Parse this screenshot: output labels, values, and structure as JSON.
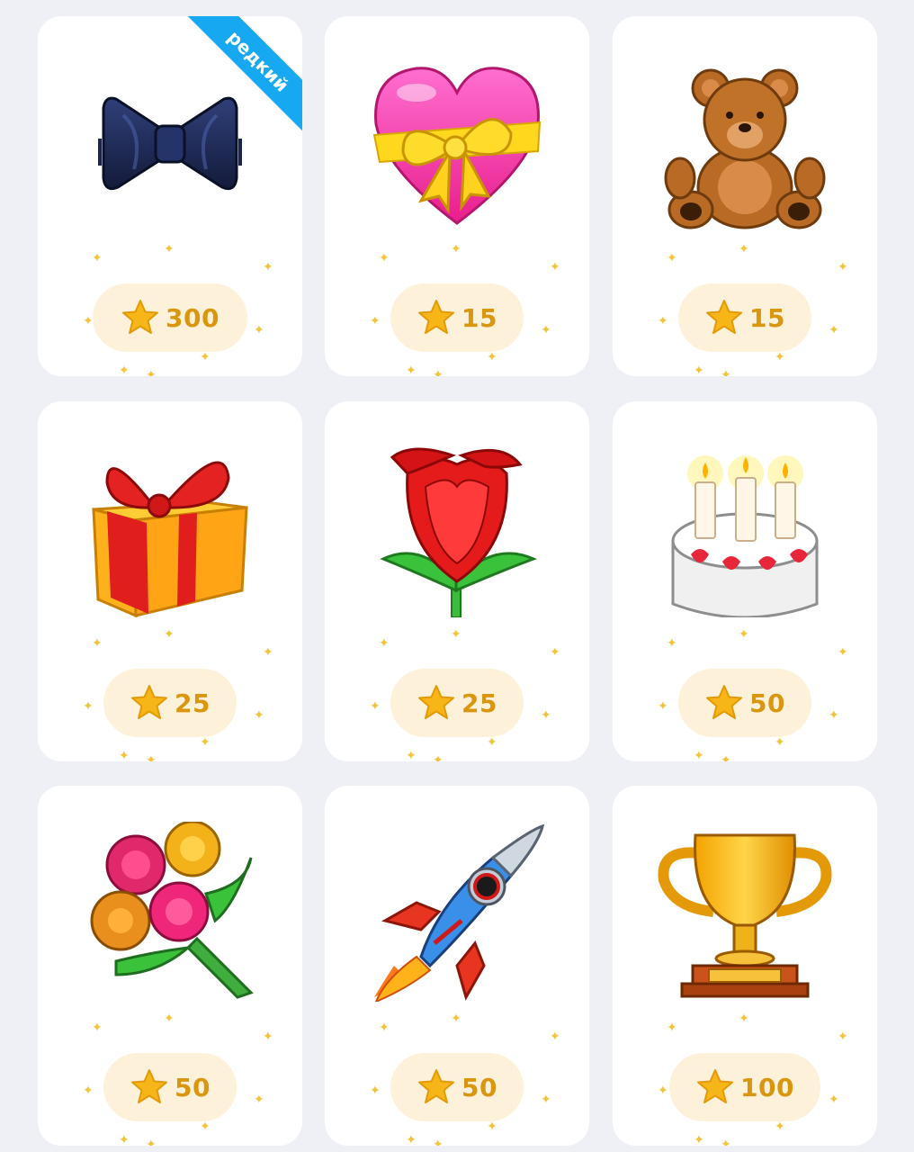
{
  "gifts": [
    {
      "name": "bow-tie",
      "price": "300",
      "badge": "редкий"
    },
    {
      "name": "heart-with-ribbon",
      "price": "15"
    },
    {
      "name": "teddy-bear",
      "price": "15"
    },
    {
      "name": "gift-box",
      "price": "25"
    },
    {
      "name": "rose",
      "price": "25"
    },
    {
      "name": "birthday-cake",
      "price": "50"
    },
    {
      "name": "bouquet",
      "price": "50"
    },
    {
      "name": "rocket",
      "price": "50"
    },
    {
      "name": "trophy",
      "price": "100"
    }
  ],
  "colors": {
    "background": "#eef0f5",
    "card": "#ffffff",
    "price_pill": "#fdf2d9",
    "price_text": "#d9960e",
    "badge": "#16a8f0"
  },
  "icons": {
    "price_icon": "star-icon"
  }
}
